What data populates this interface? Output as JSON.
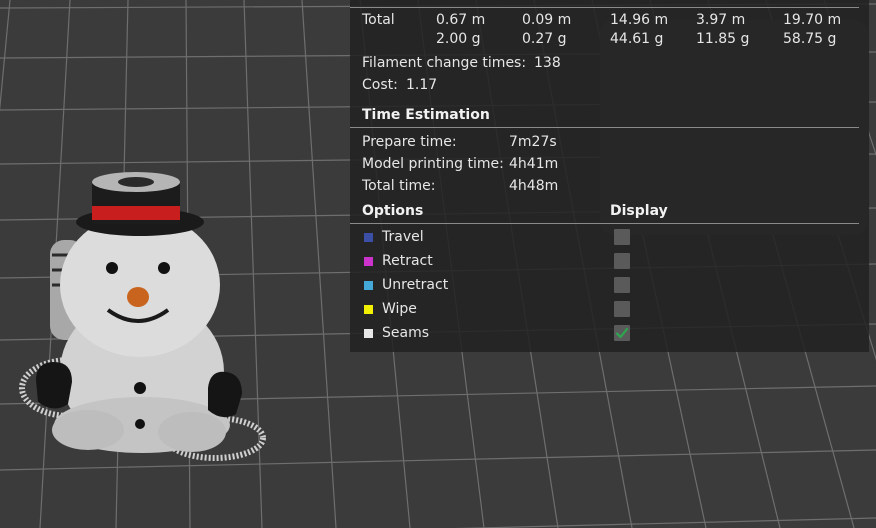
{
  "summary": {
    "total_label": "Total",
    "columns": [
      {
        "length": "0.67 m",
        "weight": "2.00 g"
      },
      {
        "length": "0.09 m",
        "weight": "0.27 g"
      },
      {
        "length": "14.96 m",
        "weight": "44.61 g"
      },
      {
        "length": "3.97 m",
        "weight": "11.85 g"
      },
      {
        "length": "19.70 m",
        "weight": "58.75 g"
      }
    ],
    "filament_change_label": "Filament change times:",
    "filament_change_value": "138",
    "cost_label": "Cost:",
    "cost_value": "1.17"
  },
  "time_estimation": {
    "title": "Time Estimation",
    "rows": [
      {
        "label": "Prepare time:",
        "value": "7m27s"
      },
      {
        "label": "Model printing time:",
        "value": "4h41m"
      },
      {
        "label": "Total time:",
        "value": "4h48m"
      }
    ]
  },
  "options": {
    "header_options": "Options",
    "header_display": "Display",
    "items": [
      {
        "label": "Travel",
        "color": "#3b4fa6",
        "checked": false
      },
      {
        "label": "Retract",
        "color": "#cc33cc",
        "checked": false
      },
      {
        "label": "Unretract",
        "color": "#44a8d8",
        "checked": false
      },
      {
        "label": "Wipe",
        "color": "#f0f000",
        "checked": false
      },
      {
        "label": "Seams",
        "color": "#e8e8e8",
        "checked": true
      }
    ]
  },
  "colors": {
    "background": "#3a3a3a",
    "grid": "#6a6a6a",
    "panel": "#222222",
    "check": "#2ea44f"
  }
}
